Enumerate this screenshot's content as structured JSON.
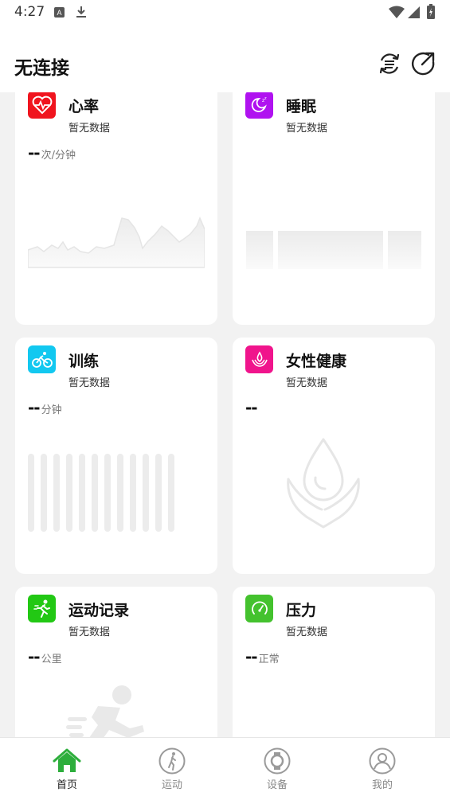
{
  "status_bar": {
    "time": "4:27"
  },
  "header": {
    "title": "无连接"
  },
  "cards": {
    "heart": {
      "title": "心率",
      "subtitle": "暂无数据",
      "value": "--",
      "unit": "次/分钟"
    },
    "sleep": {
      "title": "睡眠",
      "subtitle": "暂无数据"
    },
    "training": {
      "title": "训练",
      "subtitle": "暂无数据",
      "value": "--",
      "unit": "分钟"
    },
    "women": {
      "title": "女性健康",
      "subtitle": "暂无数据",
      "value": "--"
    },
    "exercise": {
      "title": "运动记录",
      "subtitle": "暂无数据",
      "value": "--",
      "unit": "公里"
    },
    "stress": {
      "title": "压力",
      "subtitle": "暂无数据",
      "value": "--",
      "unit": "正常"
    }
  },
  "colors": {
    "heart": "#f0141e",
    "sleep": "#b012f0",
    "training": "#12c8f0",
    "women": "#f0148c",
    "exercise": "#22c814",
    "stress": "#44c22e",
    "active_tab": "#2dae3c"
  },
  "tabs": [
    {
      "label": "首页",
      "icon": "home-icon",
      "active": true
    },
    {
      "label": "运动",
      "icon": "runner-icon",
      "active": false
    },
    {
      "label": "设备",
      "icon": "watch-icon",
      "active": false
    },
    {
      "label": "我的",
      "icon": "person-icon",
      "active": false
    }
  ]
}
